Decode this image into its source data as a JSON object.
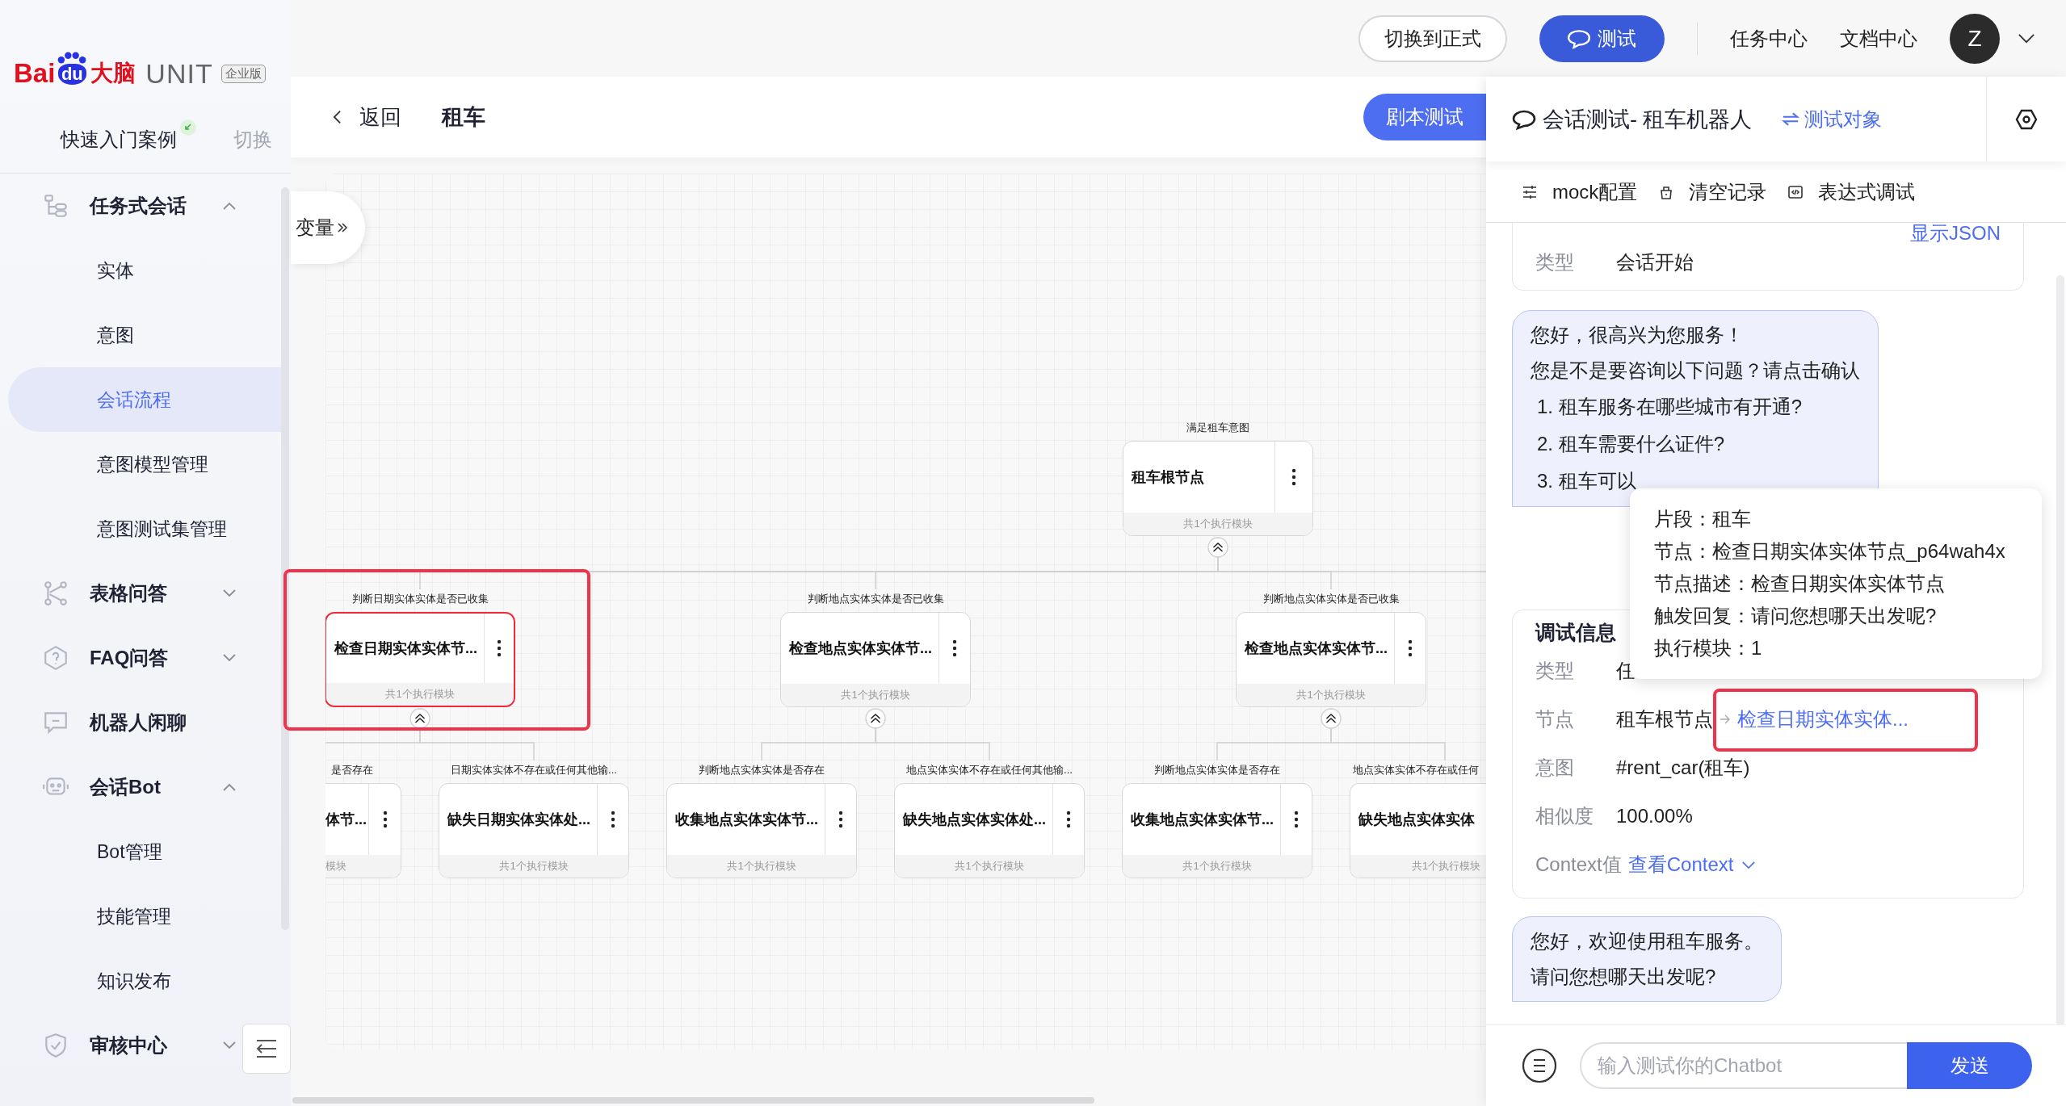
{
  "sidebar": {
    "logo": {
      "brand_left": "Bai",
      "brand_mark": "du",
      "brand_cn": "大脑",
      "product": "UNIT",
      "edition": "企业版"
    },
    "project": {
      "name": "快速入门案例",
      "switch": "切换"
    },
    "menu": [
      {
        "kind": "group",
        "label": "任务式会话",
        "expanded": true,
        "children": [
          {
            "label": "实体",
            "selected": false
          },
          {
            "label": "意图",
            "selected": false
          },
          {
            "label": "会话流程",
            "selected": true
          },
          {
            "label": "意图模型管理",
            "selected": false
          },
          {
            "label": "意图测试集管理",
            "selected": false
          }
        ]
      },
      {
        "kind": "group",
        "label": "表格问答",
        "expanded": false
      },
      {
        "kind": "group",
        "label": "FAQ问答",
        "expanded": false
      },
      {
        "kind": "link",
        "label": "机器人闲聊"
      },
      {
        "kind": "group",
        "label": "会话Bot",
        "expanded": true,
        "children": [
          {
            "label": "Bot管理",
            "selected": false
          },
          {
            "label": "技能管理",
            "selected": false
          },
          {
            "label": "知识发布",
            "selected": false
          }
        ]
      },
      {
        "kind": "group",
        "label": "审核中心",
        "expanded": false
      }
    ]
  },
  "topbar": {
    "switch_button": "切换到正式",
    "test_button": "测试",
    "links": [
      "任务中心",
      "文档中心"
    ],
    "avatar": "Z"
  },
  "header": {
    "back": "返回",
    "title": "租车",
    "script_test": "剧本测试"
  },
  "canvas": {
    "variables_tab": "变量",
    "tree": {
      "kind": "whole",
      "condition": "满足租车意图",
      "title": "租车根节点",
      "footer": "共1个执行模块",
      "selected": false,
      "annotated": false,
      "children": [
        {
          "kind": "whole",
          "condition": "判断日期实体实体是否已收集",
          "title": "检查日期实体实体节...",
          "footer": "共1个执行模块",
          "selected": true,
          "annotated": true,
          "children": [
            {
              "kind": "cut-left",
              "condition": "是否存在",
              "title": "体节...",
              "footer": "模块",
              "selected": false,
              "annotated": false
            },
            {
              "kind": "whole",
              "condition": "日期实体实体不存在或任何其他输...",
              "title": "缺失日期实体实体处...",
              "footer": "共1个执行模块",
              "selected": false,
              "annotated": false
            }
          ]
        },
        {
          "kind": "whole",
          "condition": "判断地点实体实体是否已收集",
          "title": "检查地点实体实体节...",
          "footer": "共1个执行模块",
          "selected": false,
          "annotated": false,
          "children": [
            {
              "kind": "whole",
              "condition": "判断地点实体实体是否存在",
              "title": "收集地点实体实体节...",
              "footer": "共1个执行模块",
              "selected": false,
              "annotated": false
            },
            {
              "kind": "whole",
              "condition": "地点实体实体不存在或任何其他输...",
              "title": "缺失地点实体实体处...",
              "footer": "共1个执行模块",
              "selected": false,
              "annotated": false
            }
          ]
        },
        {
          "kind": "whole",
          "condition": "判断地点实体实体是否已收集",
          "title": "检查地点实体实体节...",
          "footer": "共1个执行模块",
          "selected": false,
          "annotated": false,
          "children": [
            {
              "kind": "whole",
              "condition": "判断地点实体实体是否存在",
              "title": "收集地点实体实体节...",
              "footer": "共1个执行模块",
              "selected": false,
              "annotated": false
            },
            {
              "kind": "cut-right",
              "condition": "地点实体实体不存在或任何",
              "title": "缺失地点实体实体",
              "footer": "共1个执行模块",
              "selected": false,
              "annotated": false
            }
          ]
        }
      ]
    }
  },
  "test_panel": {
    "title": "会话测试- 租车机器人",
    "target": "测试对象",
    "tools": [
      "mock配置",
      "清空记录",
      "表达式调试"
    ],
    "messages": [
      {
        "kind": "debug",
        "link": "显示JSON",
        "rows": [
          {
            "key": "类型",
            "value": "会话开始",
            "annotated": false
          }
        ]
      },
      {
        "kind": "bot",
        "lines": [
          "您好，很高兴为您服务！",
          "您是不是要咨询以下问题？请点击确认"
        ],
        "options": [
          "1. 租车服务在哪些城市有开通?",
          "2. 租车需要什么证件?",
          "3. 租车可以"
        ]
      },
      {
        "kind": "debug",
        "title": "调试信息",
        "rows": [
          {
            "key": "类型",
            "value": "任",
            "annotated": false
          },
          {
            "key": "节点",
            "value": "租车根节点",
            "link": "检查日期实体实体...",
            "annotated": true
          },
          {
            "key": "意图",
            "value": "#rent_car(租车)",
            "annotated": false
          },
          {
            "key": "相似度",
            "value": "100.00%",
            "annotated": false
          },
          {
            "key": "Context值",
            "link": "查看Context",
            "dropdown": true,
            "annotated": false
          }
        ]
      },
      {
        "kind": "bot",
        "lines": [
          "您好，欢迎使用租车服务。",
          "请问您想哪天出发呢?"
        ]
      }
    ],
    "tooltip": [
      "片段：租车",
      "节点：检查日期实体实体节点_p64wah4x",
      "节点描述：检查日期实体实体节点",
      "触发回复：请问您想哪天出发呢?",
      "执行模块：1"
    ],
    "input": {
      "placeholder": "输入测试你的Chatbot",
      "send": "发送"
    }
  }
}
